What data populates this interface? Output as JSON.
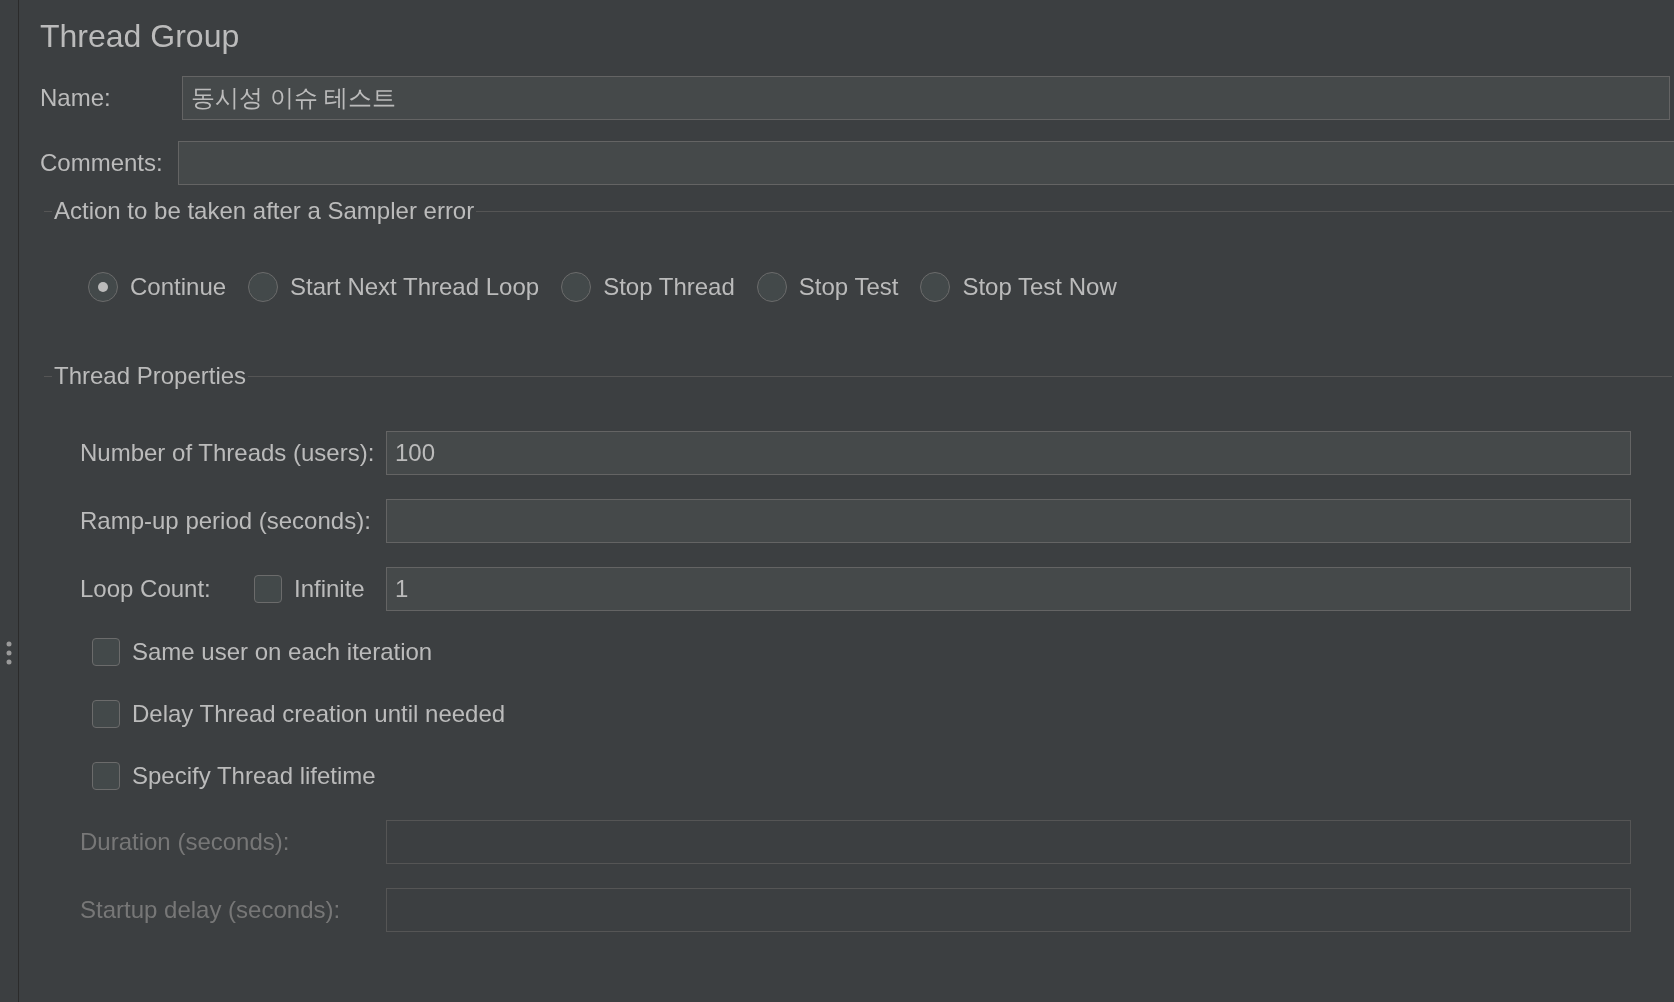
{
  "title": "Thread Group",
  "name_field": {
    "label": "Name:",
    "value": "동시성 이슈 테스트"
  },
  "comments_field": {
    "label": "Comments:"
  },
  "error_action": {
    "title": "Action to be taken after a Sampler error",
    "options": [
      {
        "label": "Continue",
        "selected": true
      },
      {
        "label": "Start Next Thread Loop",
        "selected": false
      },
      {
        "label": "Stop Thread",
        "selected": false
      },
      {
        "label": "Stop Test",
        "selected": false
      },
      {
        "label": "Stop Test Now",
        "selected": false
      }
    ]
  },
  "thread_properties": {
    "title": "Thread Properties",
    "fields": [
      {
        "kind": "text",
        "label": "Number of Threads (users):",
        "value": "100",
        "disabled": false
      },
      {
        "kind": "text",
        "label": "Ramp-up period (seconds):",
        "disabled": false
      },
      {
        "kind": "loop",
        "label": "Loop Count:",
        "checkbox": {
          "label": "Infinite",
          "checked": false
        },
        "value": "1",
        "disabled": false
      }
    ],
    "options": [
      {
        "label": "Same user on each iteration",
        "checked": false
      },
      {
        "label": "Delay Thread creation until needed",
        "checked": false
      },
      {
        "label": "Specify Thread lifetime",
        "checked": false
      }
    ],
    "lifetime_fields": [
      {
        "label": "Duration (seconds):",
        "disabled": true
      },
      {
        "label": "Startup delay (seconds):",
        "disabled": true
      }
    ]
  }
}
